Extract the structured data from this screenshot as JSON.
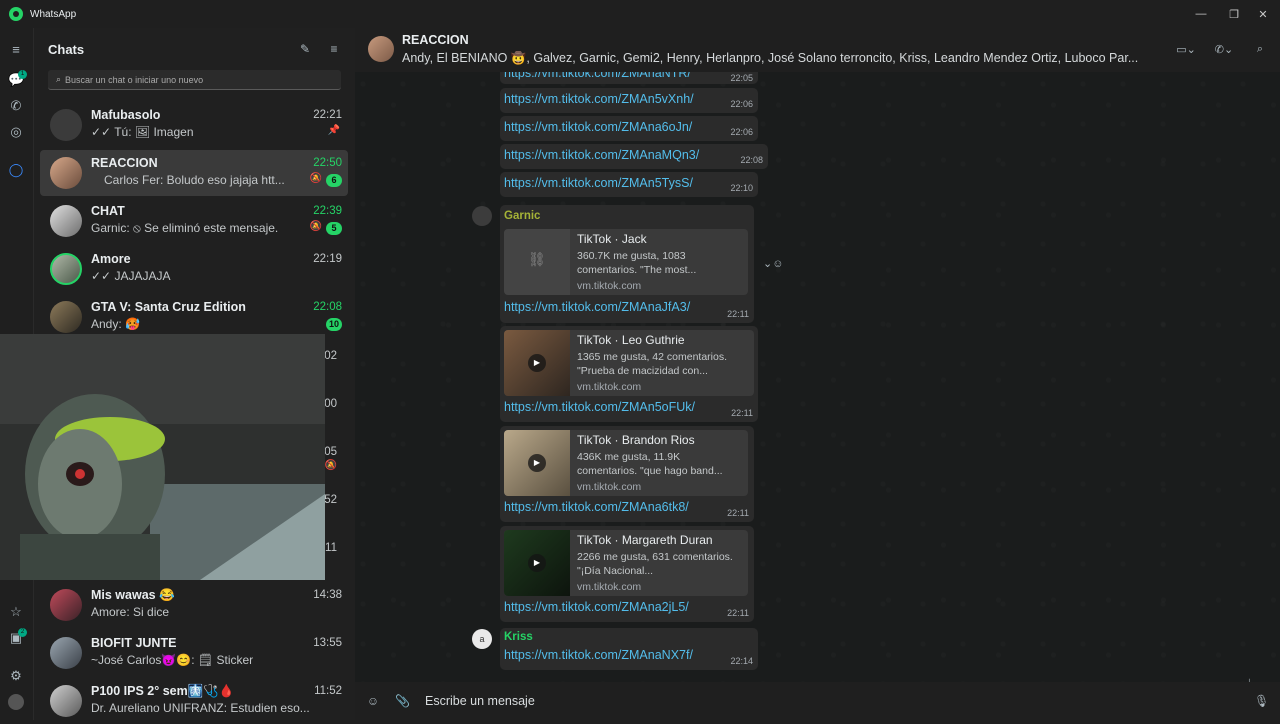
{
  "window": {
    "app_name": "WhatsApp",
    "minimize": "—",
    "restore": "❐",
    "close": "✕"
  },
  "rail": {
    "chats_badge": "1",
    "archived_badge": "2"
  },
  "sidebar": {
    "title": "Chats",
    "search_placeholder": "Buscar un chat o iniciar uno nuevo",
    "chats": [
      {
        "name": "Mafubasolo",
        "message": "✓✓ Tú: 🖼 Imagen",
        "time": "22:21",
        "pinned": true
      },
      {
        "name": "REACCION",
        "message": "Carlos Fer: Boludo eso jajaja htt...",
        "time": "22:50",
        "unread": "6",
        "muted": true
      },
      {
        "name": "CHAT",
        "message": "Garnic: ⦸ Se eliminó este mensaje.",
        "time": "22:39",
        "unread": "5",
        "muted": true
      },
      {
        "name": "Amore",
        "message": "✓✓ JAJAJAJA",
        "time": "22:19"
      },
      {
        "name": "GTA V: Santa Cruz Edition",
        "message": "Andy: 🥵",
        "time": "22:08",
        "unread": "10"
      },
      {
        "name": "Mis wawas 😂",
        "message": "Amore: Si dice",
        "time": "14:38"
      },
      {
        "name": "BIOFIT JUNTE",
        "message": "~José Carlos😈😊: 🗒 Sticker",
        "time": "13:55"
      },
      {
        "name": "P100 IPS 2° sem🩻🩺🩸",
        "message": "Dr. Aureliano UNIFRANZ: Estudien eso...",
        "time": "11:52"
      }
    ],
    "partial_times": [
      "02",
      "00",
      "05",
      "52",
      "11"
    ]
  },
  "header": {
    "title": "REACCION",
    "members": "Andy, El BENIANO 🤠, Galvez, Garnic, Gemi2, Henry, Herlanpro, José Solano terroncito, Kriss, Leandro Mendez Ortiz, Luboco Par..."
  },
  "messages": {
    "partial_top_link": "https://vm.tiktok.com/ZMAnaNTR/",
    "partial_top_time": "22:05",
    "links": [
      {
        "url": "https://vm.tiktok.com/ZMAn5vXnh/",
        "time": "22:06"
      },
      {
        "url": "https://vm.tiktok.com/ZMAna6oJn/",
        "time": "22:06"
      },
      {
        "url": "https://vm.tiktok.com/ZMAnaMQn3/",
        "time": "22:08"
      },
      {
        "url": "https://vm.tiktok.com/ZMAn5TysS/",
        "time": "22:10"
      }
    ],
    "garnic": {
      "sender": "Garnic",
      "sender_color": "#a5b337",
      "previews": [
        {
          "title": "TikTok · Jack",
          "desc": "360.7K me gusta, 1083 comentarios. \"The most...",
          "domain": "vm.tiktok.com",
          "url": "https://vm.tiktok.com/ZMAnaJfA3/",
          "time": "22:11"
        },
        {
          "title": "TikTok · Leo Guthrie",
          "desc": "1365 me gusta, 42 comentarios. \"Prueba de macizidad con...",
          "domain": "vm.tiktok.com",
          "url": "https://vm.tiktok.com/ZMAn5oFUk/",
          "time": "22:11"
        },
        {
          "title": "TikTok · Brandon Rios",
          "desc": "436K me gusta, 11.9K comentarios. \"que hago band...",
          "domain": "vm.tiktok.com",
          "url": "https://vm.tiktok.com/ZMAna6tk8/",
          "time": "22:11"
        },
        {
          "title": "TikTok · Margareth Duran",
          "desc": "2266 me gusta, 631 comentarios. \"¡Día Nacional...",
          "domain": "vm.tiktok.com",
          "url": "https://vm.tiktok.com/ZMAna2jL5/",
          "time": "22:11"
        }
      ]
    },
    "kriss": {
      "sender": "Kriss",
      "sender_color": "#25d366",
      "avatar_letter": "a",
      "url": "https://vm.tiktok.com/ZMAnaNX7f/",
      "time": "22:14"
    },
    "scroll_badge": "6"
  },
  "composer": {
    "placeholder": "Escribe un mensaje"
  },
  "colors": {
    "accent": "#25d366",
    "link": "#53bdeb",
    "bubble": "#2b2b2b"
  }
}
